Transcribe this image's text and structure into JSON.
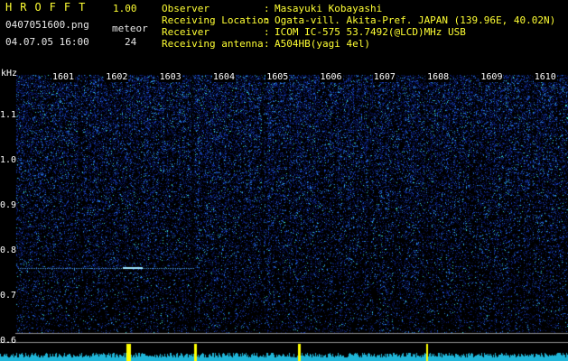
{
  "app": {
    "name": "HROFFT",
    "version": "1.00"
  },
  "file": {
    "name": "0407051600.png",
    "datetime": "04.07.05 16:00"
  },
  "meteor": {
    "label": "meteor",
    "count": "24"
  },
  "info": [
    {
      "key": "Observer",
      "value": "Masayuki Kobayashi"
    },
    {
      "key": "Receiving Location",
      "value": "Ogata-vill. Akita-Pref. JAPAN (139.96E, 40.02N)"
    },
    {
      "key": "Receiver",
      "value": "ICOM IC-575 53.7492(@LCD)MHz USB"
    },
    {
      "key": "Receiving antenna",
      "value": "A504HB(yagi 4el)"
    }
  ],
  "axis": {
    "unit": "kHz",
    "ticks": [
      {
        "label": "1.1",
        "value": 1.1
      },
      {
        "label": "1.0",
        "value": 1.0
      },
      {
        "label": "0.9",
        "value": 0.9
      },
      {
        "label": "0.8",
        "value": 0.8
      },
      {
        "label": "0.7",
        "value": 0.7
      },
      {
        "label": "0.6",
        "value": 0.6
      }
    ]
  },
  "minutes": [
    "1601",
    "1602",
    "1603",
    "1604",
    "1605",
    "1606",
    "1607",
    "1608",
    "1609",
    "1610"
  ],
  "colors": {
    "background": "#000000",
    "header_text": "#ffff33",
    "plain_text": "#e8e8e8",
    "noise_low": "#0a1a5a",
    "noise_mid": "#1f4fd0",
    "noise_high": "#3de0d0",
    "meteor": "#ffff00"
  }
}
